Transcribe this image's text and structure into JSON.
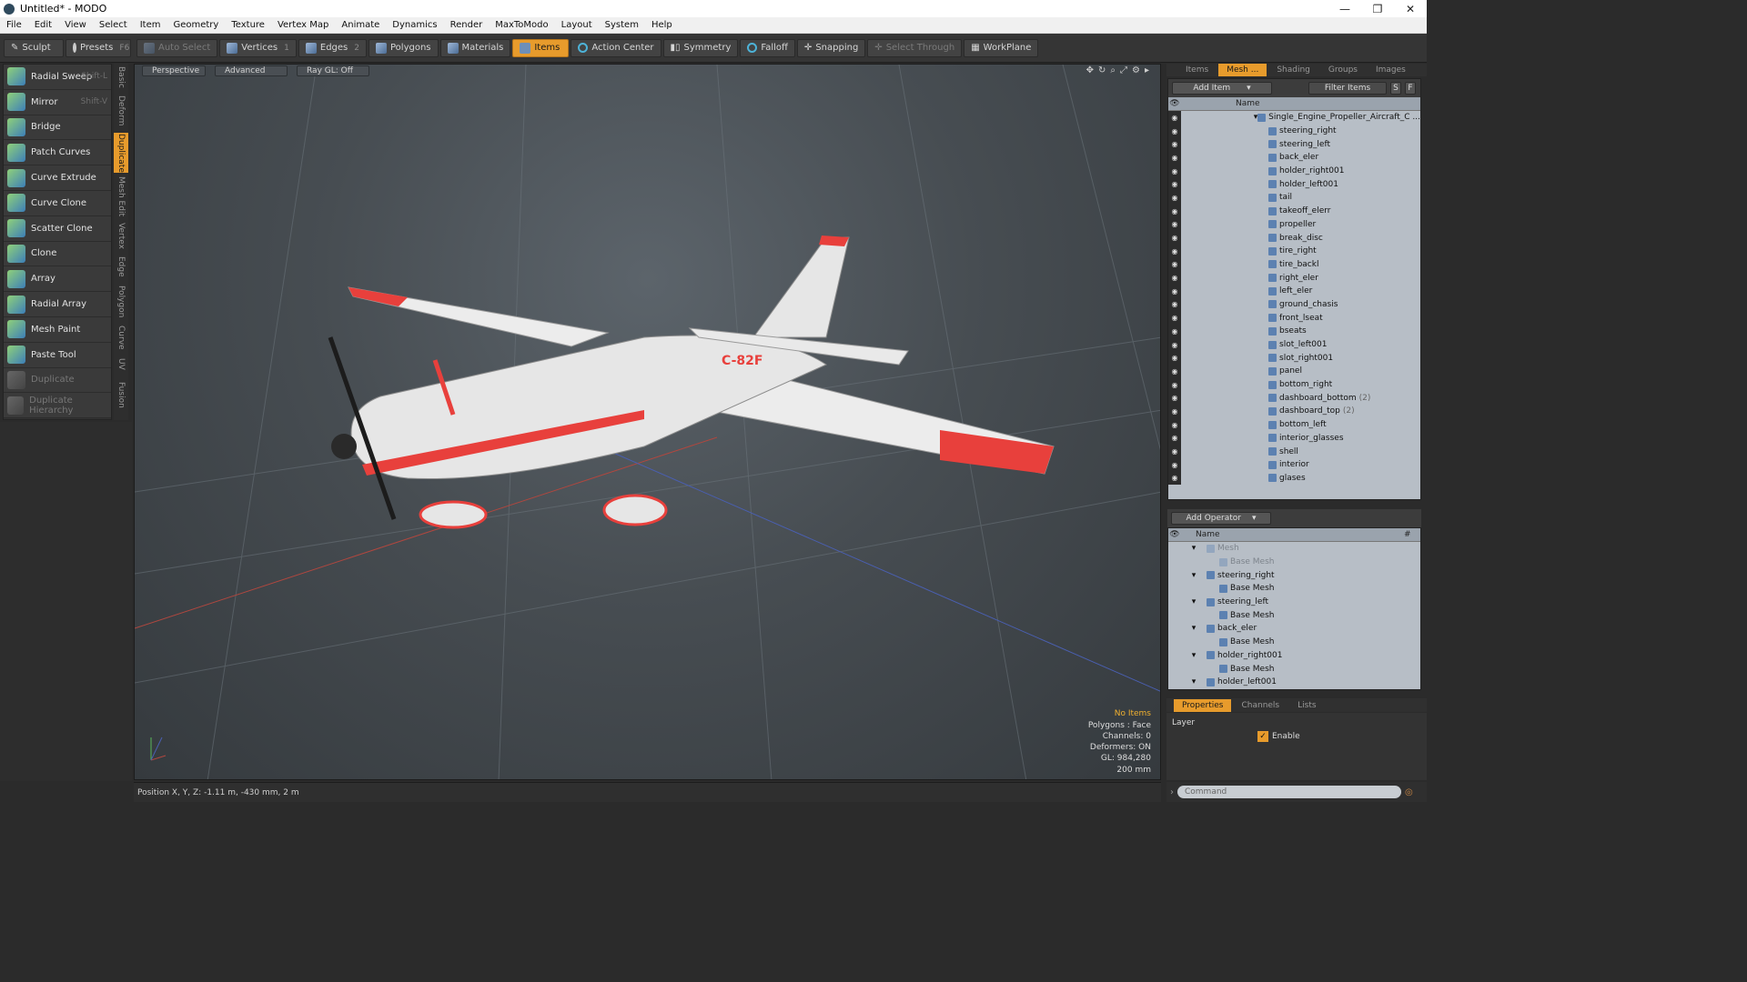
{
  "window": {
    "title": "Untitled* - MODO",
    "min": "—",
    "max": "❐",
    "close": "✕"
  },
  "menu": [
    "File",
    "Edit",
    "View",
    "Select",
    "Item",
    "Geometry",
    "Texture",
    "Vertex Map",
    "Animate",
    "Dynamics",
    "Render",
    "MaxToModo",
    "Layout",
    "System",
    "Help"
  ],
  "toolbar": {
    "sculpt": "Sculpt",
    "presets": "Presets",
    "presets_key": "F6",
    "auto_select": "Auto Select",
    "vertices": "Vertices",
    "vertices_num": "1",
    "edges": "Edges",
    "edges_num": "2",
    "polygons": "Polygons",
    "materials": "Materials",
    "items": "Items",
    "action_center": "Action Center",
    "symmetry": "Symmetry",
    "falloff": "Falloff",
    "snapping": "Snapping",
    "select_through": "Select Through",
    "workplane": "WorkPlane"
  },
  "tools": [
    {
      "label": "Radial Sweep",
      "shortcut": "Shift-L"
    },
    {
      "label": "Mirror",
      "shortcut": "Shift-V"
    },
    {
      "label": "Bridge",
      "shortcut": ""
    },
    {
      "label": "Patch Curves",
      "shortcut": ""
    },
    {
      "label": "Curve Extrude",
      "shortcut": ""
    },
    {
      "label": "Curve Clone",
      "shortcut": ""
    },
    {
      "label": "Scatter Clone",
      "shortcut": ""
    },
    {
      "label": "Clone",
      "shortcut": ""
    },
    {
      "label": "Array",
      "shortcut": ""
    },
    {
      "label": "Radial Array",
      "shortcut": ""
    },
    {
      "label": "Mesh Paint",
      "shortcut": ""
    },
    {
      "label": "Paste Tool",
      "shortcut": ""
    },
    {
      "label": "Duplicate",
      "shortcut": ""
    },
    {
      "label": "Duplicate Hierarchy",
      "shortcut": ""
    }
  ],
  "vtabs": [
    "Basic",
    "Deform",
    "Duplicate",
    "Mesh Edit",
    "Vertex",
    "Edge",
    "Polygon",
    "Curve",
    "UV",
    "Fusion"
  ],
  "viewport": {
    "perspective": "Perspective",
    "advanced": "Advanced",
    "raygl": "Ray GL: Off",
    "tail_text": "C-82F",
    "info": [
      "No Items",
      "Polygons : Face",
      "Channels: 0",
      "Deformers: ON",
      "GL: 984,280",
      "200 mm"
    ]
  },
  "status": {
    "position": "Position X, Y, Z:  -1.11 m, -430 mm, 2 m"
  },
  "right_tabs": [
    "Items",
    "Mesh ...",
    "Shading",
    "Groups",
    "Images"
  ],
  "items_panel": {
    "add_item": "Add Item",
    "filter": "Filter Items",
    "s": "S",
    "f": "F",
    "name_col": "Name",
    "root": "Single_Engine_Propeller_Aircraft_C ...",
    "items": [
      "steering_right",
      "steering_left",
      "back_eler",
      "holder_right001",
      "holder_left001",
      "tail",
      "takeoff_elerr",
      "propeller",
      "break_disc",
      "tire_right",
      "tire_backl",
      "right_eler",
      "left_eler",
      "ground_chasis",
      "front_lseat",
      "bseats",
      "slot_left001",
      "slot_right001",
      "panel",
      "bottom_right",
      "dashboard_bottom",
      "dashboard_top",
      "bottom_left",
      "interior_glasses",
      "shell",
      "interior",
      "glases"
    ],
    "counts": {
      "dashboard_bottom": "(2)",
      "dashboard_top": "(2)"
    }
  },
  "operator_panel": {
    "add_operator": "Add Operator",
    "name_col": "Name",
    "hash": "#",
    "rows": [
      {
        "label": "Mesh",
        "level": 0,
        "dim": true
      },
      {
        "label": "Base Mesh",
        "level": 1,
        "dim": true
      },
      {
        "label": "steering_right",
        "level": 0,
        "dim": false
      },
      {
        "label": "Base Mesh",
        "level": 1,
        "dim": false
      },
      {
        "label": "steering_left",
        "level": 0,
        "dim": false
      },
      {
        "label": "Base Mesh",
        "level": 1,
        "dim": false
      },
      {
        "label": "back_eler",
        "level": 0,
        "dim": false
      },
      {
        "label": "Base Mesh",
        "level": 1,
        "dim": false
      },
      {
        "label": "holder_right001",
        "level": 0,
        "dim": false
      },
      {
        "label": "Base Mesh",
        "level": 1,
        "dim": false
      },
      {
        "label": "holder_left001",
        "level": 0,
        "dim": false
      }
    ]
  },
  "properties": {
    "tabs": [
      "Properties",
      "Channels",
      "Lists"
    ],
    "layer": "Layer",
    "enable": "Enable"
  },
  "command": {
    "placeholder": "Command"
  },
  "colors": {
    "accent": "#e79b2c",
    "plane_red": "#e8403c"
  }
}
